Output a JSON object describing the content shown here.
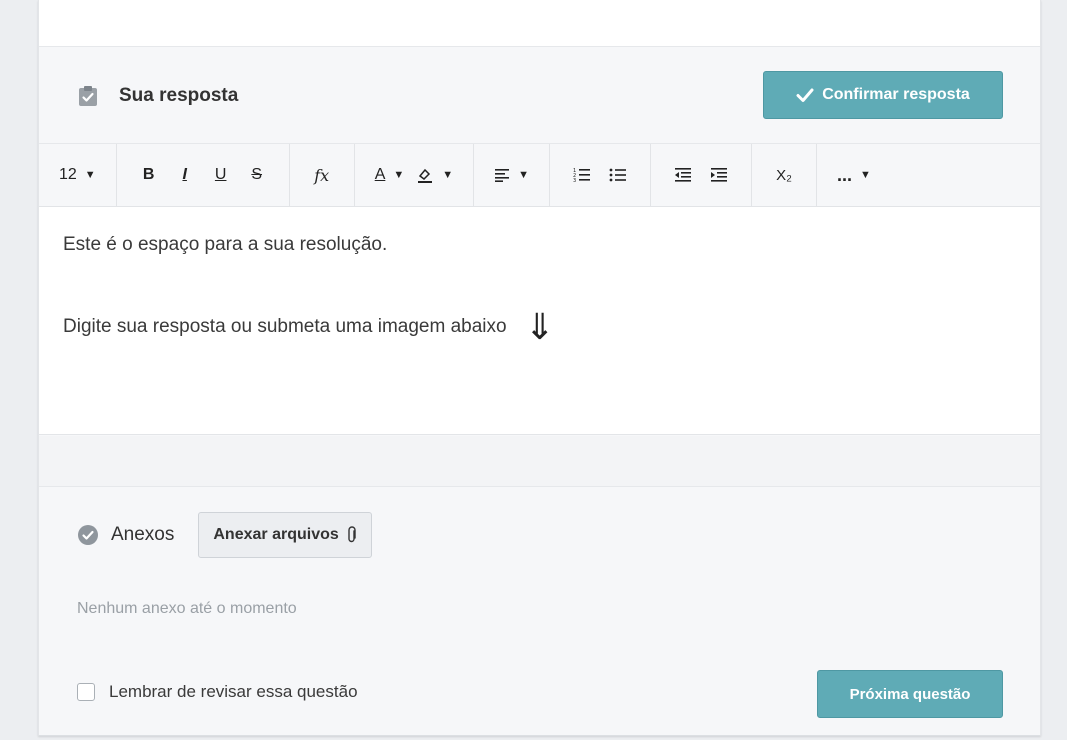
{
  "answer": {
    "title": "Sua resposta",
    "confirm_label": "Confirmar resposta"
  },
  "toolbar": {
    "font_size": "12",
    "bold": "B",
    "italic": "I",
    "underline": "U",
    "strike": "S",
    "formula": "fx",
    "font_color": "A",
    "subscript": "X₂",
    "more": "...",
    "icons": [
      "caret-down-icon",
      "bold-icon",
      "italic-icon",
      "underline-icon",
      "strikethrough-icon",
      "formula-icon",
      "font-color-icon",
      "highlight-icon",
      "align-icon",
      "ordered-list-icon",
      "unordered-list-icon",
      "outdent-icon",
      "indent-icon",
      "subscript-icon",
      "more-icon"
    ]
  },
  "editor": {
    "line1": "Este é o espaço para a sua resolução.",
    "line2": "Digite sua resposta ou submeta uma imagem abaixo",
    "arrow": "⇓"
  },
  "attachments": {
    "title": "Anexos",
    "attach_label": "Anexar arquivos",
    "empty_text": "Nenhum anexo até o momento"
  },
  "footer": {
    "review_label": "Lembrar de revisar essa questão",
    "review_checked": false,
    "next_label": "Próxima questão"
  },
  "colors": {
    "accent": "#5fabb6",
    "background": "#eceef1"
  }
}
